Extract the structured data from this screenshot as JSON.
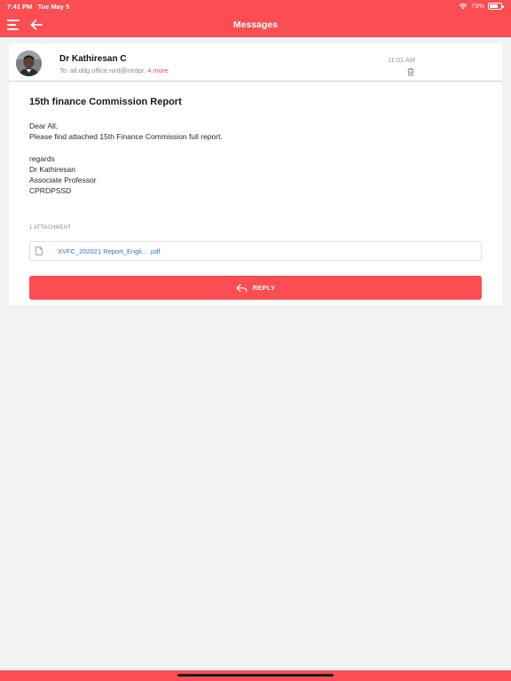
{
  "status_bar": {
    "time": "7:41 PM",
    "date": "Tue May 5",
    "battery": "73%",
    "battery_level": 0.73
  },
  "header": {
    "title": "Messages",
    "bg_color": "#fb4d52"
  },
  "email": {
    "sender": "Dr Kathiresan C",
    "to_prefix": "To:",
    "to_address": "all.ddg.office.nird@nirdpr,",
    "more_label": "4 more",
    "time": "11:01 AM",
    "subject": "15th finance Commission Report",
    "body_lines": [
      "Dear All,",
      "Please find attached 15th Finance Commission full report.",
      "",
      "regards",
      "Dr Kathiresan",
      "Associate Professor",
      "CPRDPSSD"
    ],
    "attachments_label": "1 ATTACHMENT",
    "attachments": [
      {
        "name": "XVFC_202021 Report_Engli... .pdf",
        "icon": "file-icon"
      }
    ]
  },
  "actions": {
    "reply_label": "REPLY",
    "reply_icon": "reply-icon"
  },
  "colors": {
    "accent": "#fb4d52",
    "link": "#2f6fd6",
    "more_link": "#f0474c"
  }
}
